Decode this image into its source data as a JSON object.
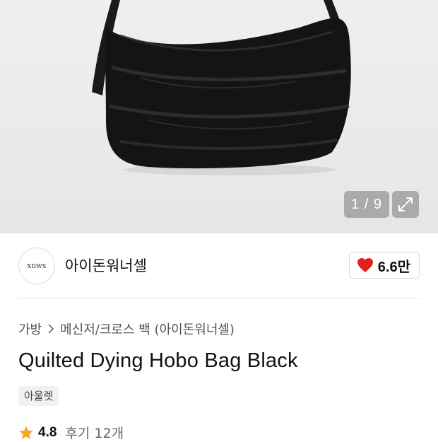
{
  "gallery": {
    "pager_text": "1 / 9",
    "image_alt": "product-photo-black-quilted-hobo-bag"
  },
  "brand": {
    "logo_text": "XDWS",
    "name": "아이돈워너셀",
    "like_count": "6.6만",
    "like_color": "#e0211d"
  },
  "breadcrumb": {
    "category": "가방",
    "subcategory": "메신저/크로스 백 (아이돈워너셀)"
  },
  "product": {
    "title": "Quilted Dying Hobo Bag Black",
    "badge": "아울렛"
  },
  "rating": {
    "score": "4.8",
    "reviews": "후기 12개",
    "star_color": "#f5a623"
  }
}
